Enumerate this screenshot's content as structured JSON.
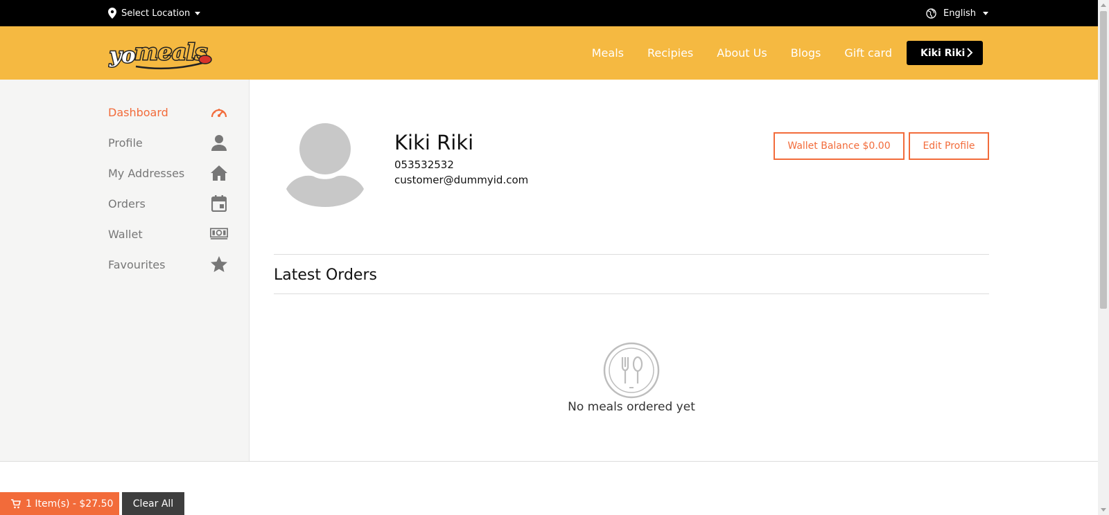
{
  "topbar": {
    "location_label": "Select Location",
    "language_label": "English"
  },
  "header": {
    "logo_text": "yomeals",
    "nav": [
      "Meals",
      "Recipies",
      "About Us",
      "Blogs",
      "Gift card"
    ],
    "user_label": "Kiki Riki"
  },
  "sidebar": {
    "items": [
      {
        "label": "Dashboard",
        "icon": "speedometer-icon",
        "active": true
      },
      {
        "label": "Profile",
        "icon": "person-icon",
        "active": false
      },
      {
        "label": "My Addresses",
        "icon": "home-icon",
        "active": false
      },
      {
        "label": "Orders",
        "icon": "calendar-icon",
        "active": false
      },
      {
        "label": "Wallet",
        "icon": "money-icon",
        "active": false
      },
      {
        "label": "Favourites",
        "icon": "star-icon",
        "active": false
      }
    ]
  },
  "profile": {
    "name": "Kiki Riki",
    "phone": "053532532",
    "email": "customer@dummyid.com",
    "wallet_button": "Wallet Balance $0.00",
    "edit_button": "Edit Profile"
  },
  "orders": {
    "title": "Latest Orders",
    "empty_text": "No meals ordered yet"
  },
  "cart": {
    "summary": "1 Item(s) - $27.50",
    "clear_label": "Clear All"
  },
  "colors": {
    "accent": "#f26b3a",
    "header_bg": "#f5b941",
    "topbar_bg": "#000000"
  }
}
